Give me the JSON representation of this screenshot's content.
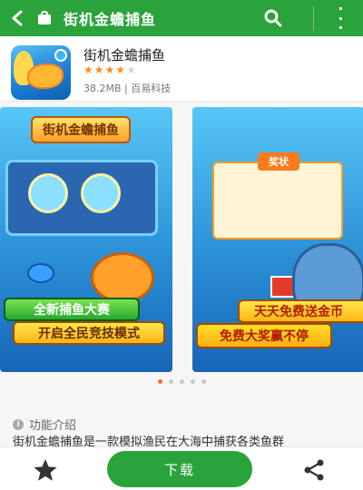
{
  "header": {
    "title": "街机金蟾捕鱼"
  },
  "app": {
    "name": "街机金蟾捕鱼",
    "rating": 4,
    "max_rating": 5,
    "size": "38.2MB",
    "separator": "|",
    "developer": "百易科技"
  },
  "screenshots": [
    {
      "logo": "街机金蟾捕鱼",
      "banner_top": "全新捕鱼大赛",
      "banner_bottom": "开启全民竞技模式"
    },
    {
      "dialog_title": "奖状",
      "banner_top": "天天免费送金币",
      "banner_bottom": "免费大奖赢不停"
    }
  ],
  "pager": {
    "count": 5,
    "active_index": 0
  },
  "features": {
    "label": "功能介绍",
    "info_icon_text": "i"
  },
  "description": "街机金蟾捕鱼是一款模拟渔民在大海中捕获各类鱼群",
  "bottom": {
    "download_label": "下载"
  },
  "colors": {
    "brand_green": "#2aa33a",
    "star": "#ff8a1f",
    "active_dot": "#ff6a2a"
  }
}
